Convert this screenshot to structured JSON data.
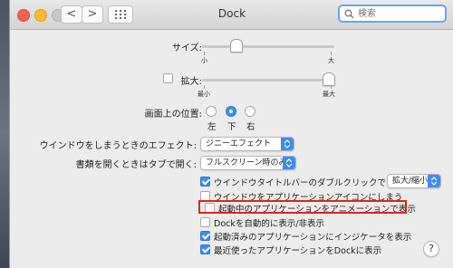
{
  "window": {
    "title": "Dock"
  },
  "search": {
    "placeholder": "検索"
  },
  "nav": {
    "back": "<",
    "forward": ">"
  },
  "size": {
    "label": "サイズ:",
    "min_label": "小",
    "max_label": "大",
    "value": 0.2
  },
  "magnification": {
    "label": "拡大:",
    "checked": false,
    "min_label": "最小",
    "max_label": "最大",
    "value": 1.0
  },
  "position": {
    "label": "画面上の位置:",
    "options": [
      "左",
      "下",
      "右"
    ],
    "selected": "下"
  },
  "minimize_effect": {
    "label": "ウインドウをしまうときのエフェクト:",
    "value": "ジニーエフェクト"
  },
  "tabs_open": {
    "label": "書類を開くときはタブで開く:",
    "value": "フルスクリーン時のみ"
  },
  "double_click": {
    "label": "ウインドウタイトルバーのダブルクリックで",
    "checked": true,
    "value": "拡大/縮小"
  },
  "options": [
    {
      "label": "ウインドウをアプリケーションアイコンにしまう",
      "checked": false
    },
    {
      "label": "起動中のアプリケーションをアニメーションで表示",
      "checked": false
    },
    {
      "label": "Dockを自動的に表示/非表示",
      "checked": false
    },
    {
      "label": "起動済みのアプリケーションにインジケータを表示",
      "checked": true
    },
    {
      "label": "最近使ったアプリケーションをDockに表示",
      "checked": true
    }
  ],
  "help": {
    "label": "?"
  },
  "colors": {
    "accent": "#3d8cf5",
    "highlight": "#e0231b"
  }
}
